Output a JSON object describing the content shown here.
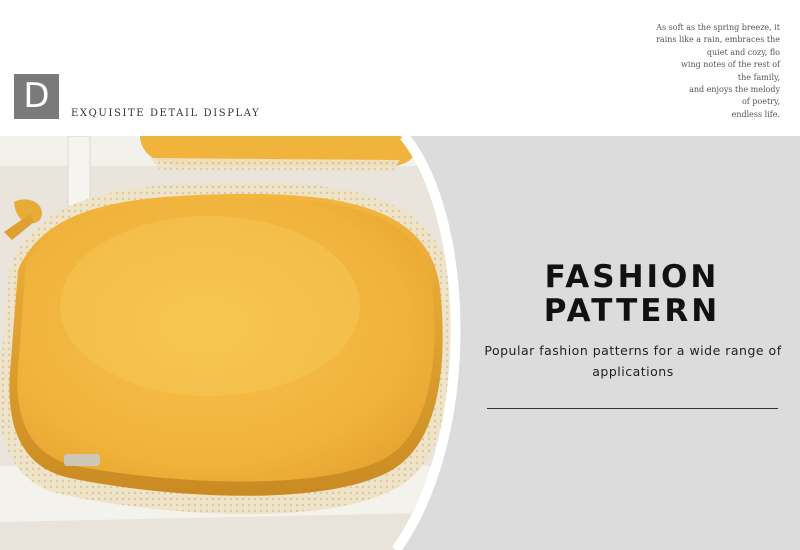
{
  "header": {
    "badge_letter": "D",
    "section_label": "EXQUISITE DETAIL DISPLAY",
    "poem_lines": [
      "As soft as the spring breeze, it",
      "rains like a rain, embraces the",
      "quiet and cozy, flo",
      "wing notes of the rest of",
      "the family,",
      "and enjoys the melody",
      "of poetry,",
      "endless life."
    ]
  },
  "feature": {
    "title_line1": "FASHION",
    "title_line2": "PATTERN",
    "description": "Popular fashion patterns for a wide range of applications"
  },
  "colors": {
    "badge": "#7a7a7a",
    "panel_background": "#dcdcdc",
    "cushion": "#f2b53f",
    "lace": "#efe2c6"
  }
}
